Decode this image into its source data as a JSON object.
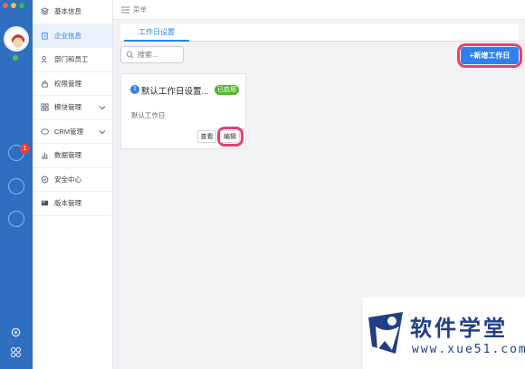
{
  "topbar": {
    "menu_label": "菜单"
  },
  "sidebar": {
    "items": [
      {
        "label": "基本信息",
        "icon": "layers-icon"
      },
      {
        "label": "企业信息",
        "icon": "building-icon"
      },
      {
        "label": "部门和员工",
        "icon": "users-icon"
      },
      {
        "label": "权限管理",
        "icon": "lock-icon"
      },
      {
        "label": "模块管理",
        "icon": "grid-icon"
      },
      {
        "label": "CRM管理",
        "icon": "crm-icon"
      },
      {
        "label": "数据管理",
        "icon": "bar-chart-icon"
      },
      {
        "label": "安全中心",
        "icon": "shield-icon"
      },
      {
        "label": "版本管理",
        "icon": "version-icon"
      }
    ],
    "active_index": 1
  },
  "rail": {
    "chat_badge": "1"
  },
  "tabs": [
    {
      "label": "工作日设置"
    }
  ],
  "search": {
    "placeholder": "搜索..."
  },
  "toolbar": {
    "add_label": "+新增工作日"
  },
  "cards": [
    {
      "index": "1",
      "name": "默认工作日设置...",
      "status": "已启用",
      "description": "默认工作日",
      "view_label": "查看",
      "edit_label": "编辑"
    }
  ],
  "watermark": {
    "brand": "软件学堂",
    "url": "www.xue51.com"
  },
  "colors": {
    "rail": "#2f6fc0",
    "accent": "#2f80ed",
    "highlight": "#e93e6f",
    "status_green": "#56b830",
    "brand": "#1f3f86"
  }
}
